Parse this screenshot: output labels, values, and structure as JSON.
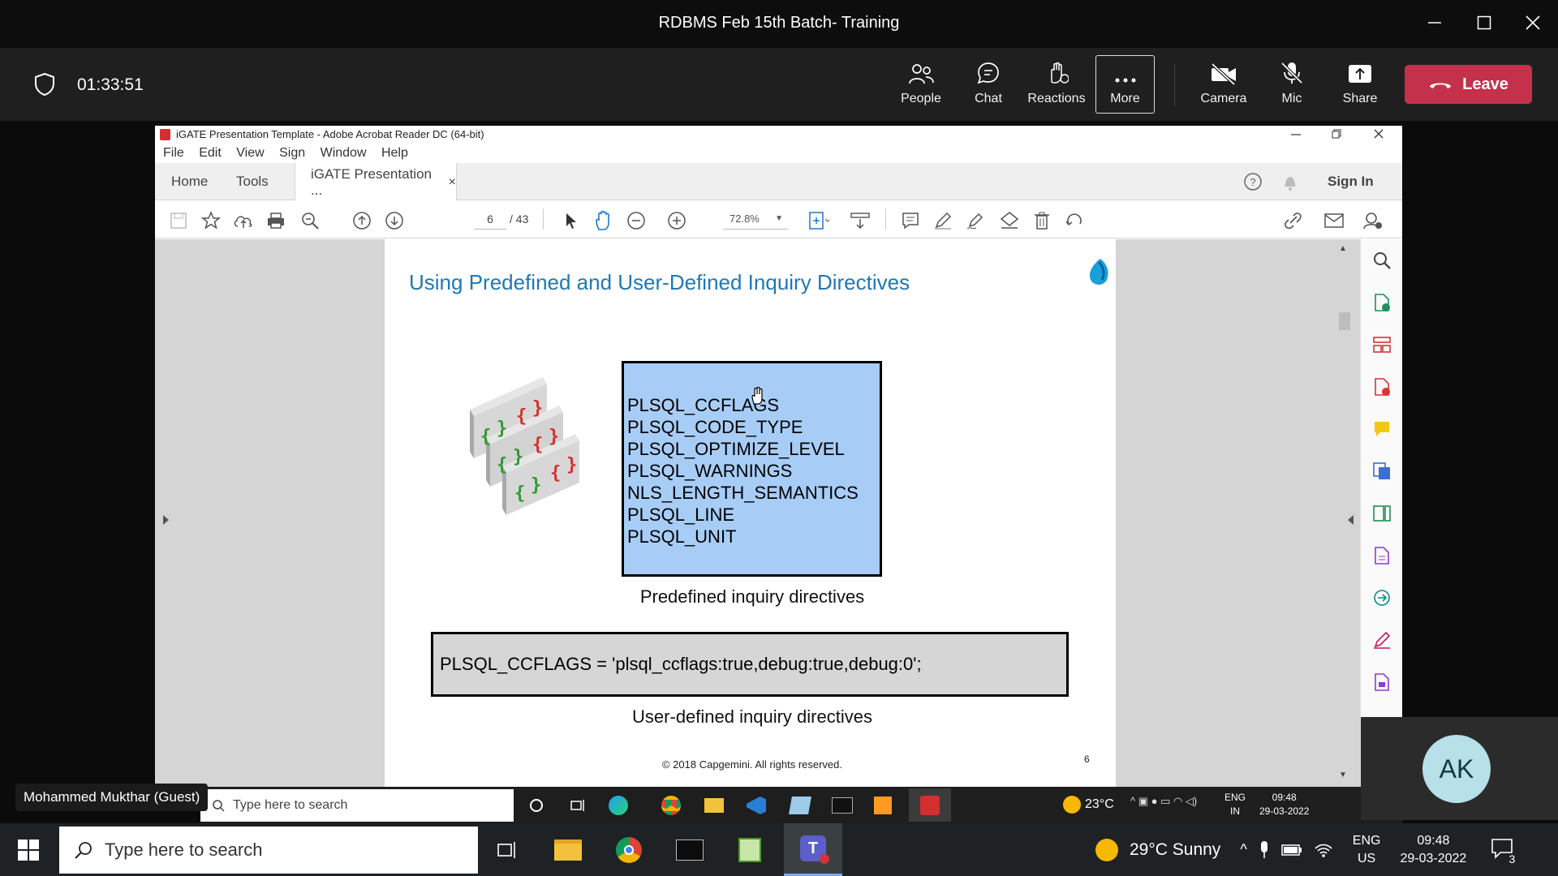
{
  "meeting": {
    "title": "RDBMS Feb 15th Batch- Training",
    "timer": "01:33:51",
    "tools": [
      {
        "label": "People",
        "icon": "people-icon"
      },
      {
        "label": "Chat",
        "icon": "chat-icon"
      },
      {
        "label": "Reactions",
        "icon": "reactions-icon"
      },
      {
        "label": "More",
        "icon": "more-icon"
      },
      {
        "label": "Camera",
        "icon": "camera-off-icon"
      },
      {
        "label": "Mic",
        "icon": "mic-off-icon"
      },
      {
        "label": "Share",
        "icon": "share-icon"
      }
    ],
    "leave_label": "Leave",
    "leave_color": "#c4314b",
    "presenter_label": "Mohammed Mukthar (Guest)",
    "participant_initials": "AK"
  },
  "acrobat": {
    "window_title": "iGATE Presentation Template - Adobe Acrobat Reader DC (64-bit)",
    "menu": [
      "File",
      "Edit",
      "View",
      "Sign",
      "Window",
      "Help"
    ],
    "tabs": {
      "home": "Home",
      "tools": "Tools",
      "document": "iGATE Presentation ...",
      "close": "×"
    },
    "sign_in": "Sign In",
    "page_current": "6",
    "page_total": "/ 43",
    "zoom": "72.8%"
  },
  "slide": {
    "title": "Using Predefined and User-Defined Inquiry Directives",
    "predefined": [
      "PLSQL_CCFLAGS",
      "PLSQL_CODE_TYPE",
      "PLSQL_OPTIMIZE_LEVEL",
      "PLSQL_WARNINGS",
      "NLS_LENGTH_SEMANTICS",
      "PLSQL_LINE",
      "PLSQL_UNIT"
    ],
    "predefined_caption": "Predefined inquiry directives",
    "user_defined_code": "PLSQL_CCFLAGS = 'plsql_ccflags:true,debug:true,debug:0';",
    "user_defined_caption": "User-defined inquiry directives",
    "copyright": "© 2018 Capgemini. All rights reserved.",
    "page_number": "6",
    "box_color": "#a7cdf7"
  },
  "inner_taskbar": {
    "search_placeholder": "Type here to search",
    "weather": "23°C",
    "lang_top": "ENG",
    "lang_bottom": "IN",
    "time": "09:48",
    "date": "29-03-2022"
  },
  "taskbar": {
    "search_placeholder": "Type here to search",
    "weather": "29°C  Sunny",
    "lang_top": "ENG",
    "lang_bottom": "US",
    "time": "09:48",
    "date": "29-03-2022",
    "notification_count": "3"
  }
}
